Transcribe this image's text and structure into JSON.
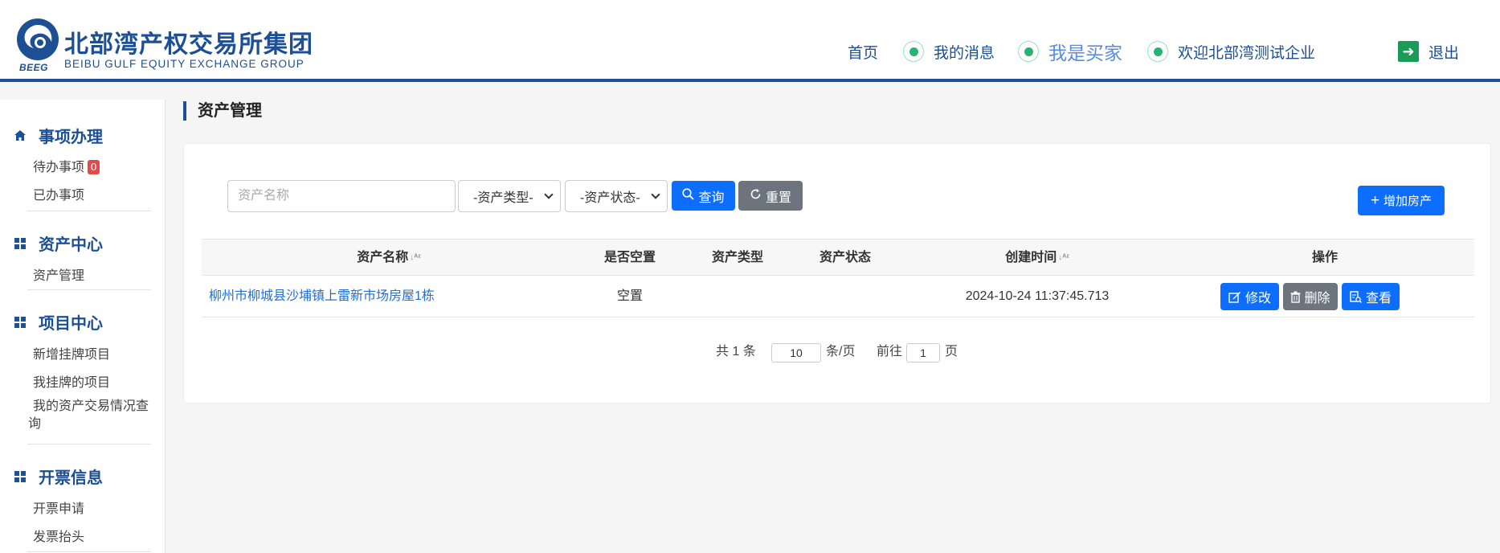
{
  "header": {
    "logo_cn": "北部湾产权交易所集团",
    "logo_en": "BEIBU GULF EQUITY EXCHANGE GROUP",
    "logo_abbr": "BEEG",
    "nav": {
      "home": "首页",
      "messages": "我的消息",
      "buyer": "我是买家",
      "welcome": "欢迎北部湾测试企业",
      "logout": "退出"
    }
  },
  "sidebar": {
    "groups": [
      {
        "title": "事项办理",
        "icon": "home-icon",
        "items": [
          {
            "label": "待办事项",
            "badge": "0"
          },
          {
            "label": "已办事项"
          }
        ]
      },
      {
        "title": "资产中心",
        "icon": "grid-icon",
        "items": [
          {
            "label": "资产管理"
          }
        ]
      },
      {
        "title": "项目中心",
        "icon": "grid-icon",
        "items": [
          {
            "label": "新增挂牌项目"
          },
          {
            "label": "我挂牌的项目"
          },
          {
            "label": "我的资产交易情况查询"
          }
        ]
      },
      {
        "title": "开票信息",
        "icon": "grid-icon",
        "items": [
          {
            "label": "开票申请"
          },
          {
            "label": "发票抬头"
          }
        ]
      }
    ]
  },
  "main": {
    "page_title": "资产管理",
    "filters": {
      "name_placeholder": "资产名称",
      "type_select": "-资产类型-",
      "status_select": "-资产状态-",
      "query_label": "查询",
      "reset_label": "重置",
      "add_label": "增加房产"
    },
    "table": {
      "headers": [
        "资产名称",
        "是否空置",
        "资产类型",
        "资产状态",
        "创建时间",
        "操作"
      ],
      "rows": [
        {
          "name": "柳州市柳城县沙埔镇上雷新市场房屋1栋",
          "vacant": "空置",
          "type": "",
          "status": "",
          "created": "2024-10-24 11:37:45.713"
        }
      ],
      "actions": {
        "edit": "修改",
        "delete": "删除",
        "view": "查看"
      }
    },
    "pagination": {
      "total_prefix": "共",
      "total": "1",
      "total_suffix": "条",
      "page_size": "10",
      "page_size_suffix": "条/页",
      "goto_prefix": "前往",
      "current_page": "1",
      "goto_suffix": "页"
    }
  },
  "colors": {
    "brand": "#1c4f93",
    "primary": "#0d6efd",
    "gray": "#6c757d",
    "badge": "#e04b4b",
    "link": "#1f6fd6"
  }
}
